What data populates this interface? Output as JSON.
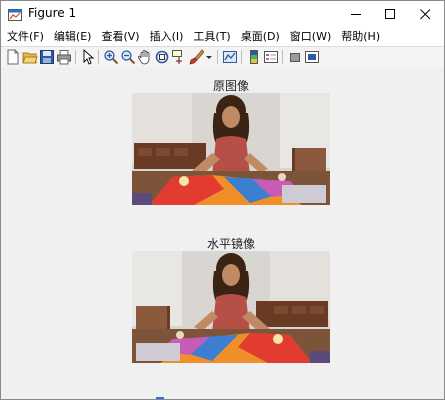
{
  "window": {
    "title": "Figure 1"
  },
  "menu": [
    "文件(F)",
    "编辑(E)",
    "查看(V)",
    "插入(I)",
    "工具(T)",
    "桌面(D)",
    "窗口(W)",
    "帮助(H)"
  ],
  "toolbar": {
    "buttons": [
      "new-figure",
      "open-file",
      "save",
      "print",
      "edit-plot",
      "zoom-in",
      "zoom-out",
      "pan",
      "rotate-3d",
      "data-cursor",
      "brush",
      "link-plot",
      "insert-colorbar",
      "insert-legend",
      "hide-plot-tools",
      "show-plot-tools"
    ]
  },
  "figure": {
    "axes": [
      {
        "title": "原图像",
        "image": "woman-smiling-colorful-fabric-original"
      },
      {
        "title": "水平镜像",
        "image": "woman-smiling-colorful-fabric-mirrored"
      }
    ]
  }
}
